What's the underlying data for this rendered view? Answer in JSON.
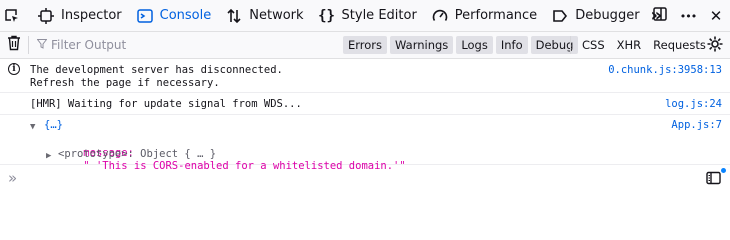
{
  "toolbar": {
    "tabs": [
      {
        "label": "Inspector",
        "icon": "inspector-icon"
      },
      {
        "label": "Console",
        "icon": "console-icon",
        "active": true
      },
      {
        "label": "Network",
        "icon": "network-icon"
      },
      {
        "label": "Style Editor",
        "icon": "style-editor-icon"
      },
      {
        "label": "Performance",
        "icon": "performance-icon"
      },
      {
        "label": "Debugger",
        "icon": "debugger-icon"
      }
    ],
    "overflow_glyph": "»",
    "menu_glyph": "•••",
    "close_glyph": "✕"
  },
  "filterbar": {
    "placeholder": "Filter Output",
    "levels": [
      "Errors",
      "Warnings",
      "Logs",
      "Info",
      "Debug"
    ],
    "network": [
      "CSS",
      "XHR",
      "Requests"
    ]
  },
  "messages": [
    {
      "type": "info",
      "line1": "The development server has disconnected.",
      "line2": "Refresh the page if necessary.",
      "location": "0.chunk.js:3958:13"
    },
    {
      "type": "log",
      "text": "[HMR] Waiting for update signal from WDS...",
      "location": "log.js:24"
    },
    {
      "type": "log-object",
      "summary": "{…}",
      "key": "message:",
      "value": "\" 'This is CORS-enabled for a whitelisted domain.'\"",
      "prototype": "<prototype>: Object { … }",
      "location": "App.js:7"
    }
  ],
  "input": {
    "prompt": "»"
  },
  "colors": {
    "accent": "#0061e0",
    "string": "#dd00a9",
    "dot": "#0a84ff"
  }
}
